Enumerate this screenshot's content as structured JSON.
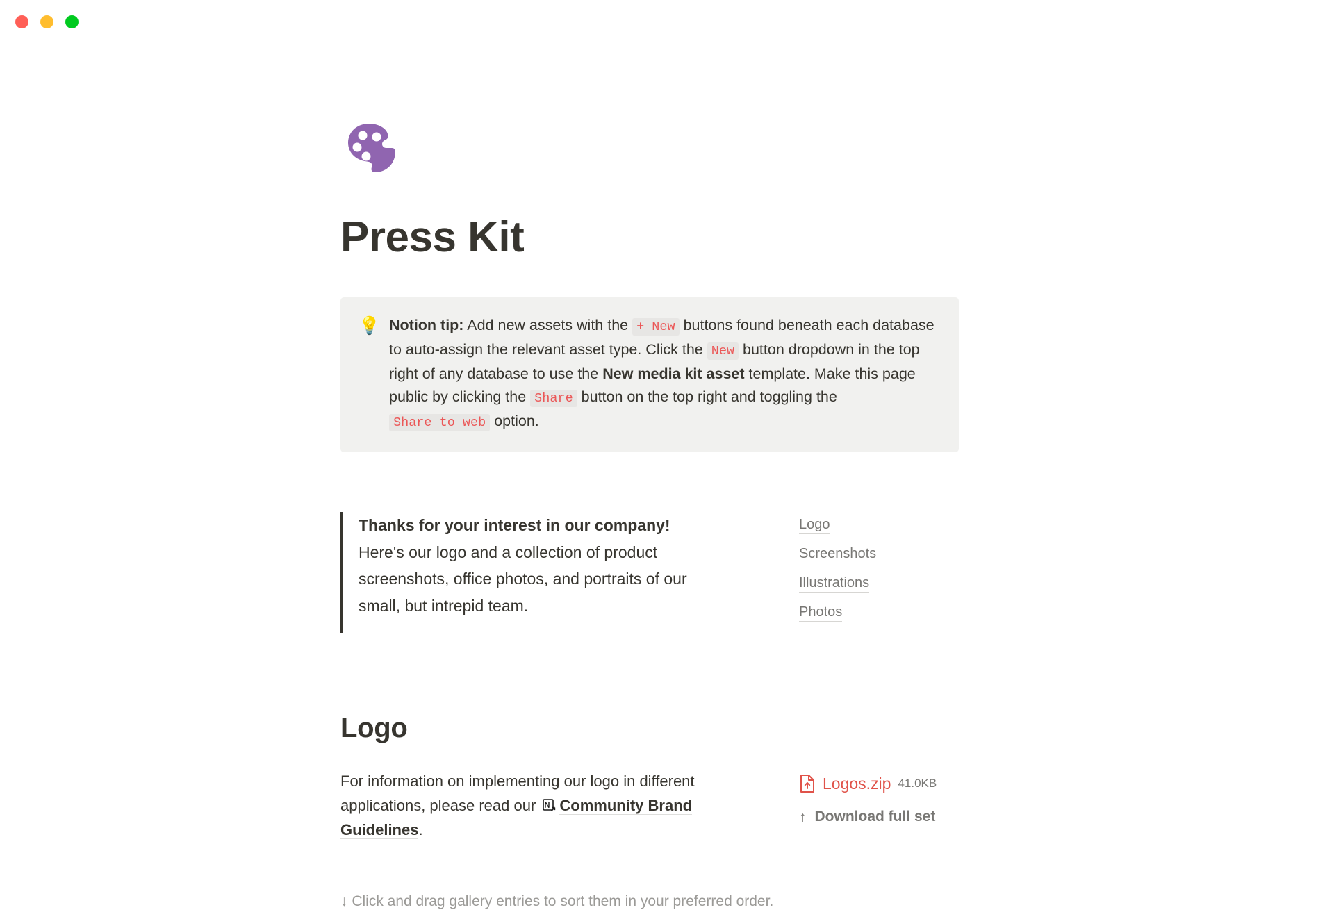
{
  "window": {
    "controls": [
      {
        "name": "close",
        "color": "#ff5f57"
      },
      {
        "name": "minimize",
        "color": "#ffbd2e"
      },
      {
        "name": "maximize",
        "color": "#00ca1f"
      }
    ]
  },
  "page": {
    "icon": "palette-icon",
    "icon_color": "#9065b0",
    "title": "Press Kit"
  },
  "callout": {
    "emoji": "💡",
    "emoji_name": "lightbulb-emoji",
    "label": "Notion tip:",
    "text_1": " Add new assets with the ",
    "code_1": "+ New",
    "text_2": " buttons found beneath each database to auto-assign the relevant asset type. Click the ",
    "code_2": "New",
    "text_3": " button dropdown in the top right of any database to use the ",
    "bold_1": "New media kit asset",
    "text_4": " template. Make this page public by clicking the ",
    "code_3": "Share",
    "text_5": " button on the top right and toggling the ",
    "code_4": "Share to web",
    "text_6": " option.",
    "code_color": "#eb5757",
    "background": "#f1f1ef"
  },
  "intro": {
    "lead": "Thanks for your interest in our company!",
    "body": "Here's our logo and a collection of product screenshots, office photos, and portraits of our small, but intrepid team."
  },
  "toc": {
    "items": [
      {
        "label": "Logo"
      },
      {
        "label": "Screenshots"
      },
      {
        "label": "Illustrations"
      },
      {
        "label": "Photos"
      }
    ]
  },
  "logo_section": {
    "title": "Logo",
    "body_1": "For information on implementing our logo in different applications, please read our ",
    "link_icon": "notion-page-icon",
    "link_label": "Community Brand Guidelines",
    "body_2": ".",
    "file": {
      "icon": "zip-file-icon",
      "name": "Logos.zip",
      "size": "41.0KB",
      "color": "#e0534a"
    },
    "download": {
      "arrow": "↑",
      "label": "Download full set"
    },
    "hint": "↓ Click and drag gallery entries to sort them in your preferred order."
  }
}
